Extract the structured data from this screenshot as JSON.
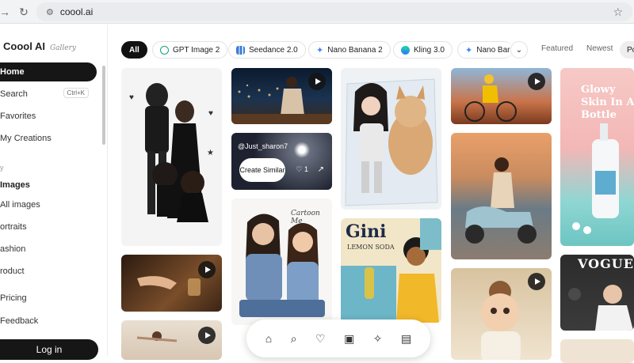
{
  "browser": {
    "url": "coool.ai"
  },
  "brand": {
    "name": "Coool AI",
    "sub": "Gallery"
  },
  "sidebar": {
    "items": [
      {
        "label": "Home"
      },
      {
        "label": "Search",
        "shortcut": "Ctrl+K"
      },
      {
        "label": "Favorites"
      },
      {
        "label": "My Creations"
      }
    ],
    "category_label": "y",
    "images_title": "Images",
    "image_items": [
      {
        "label": "All images"
      },
      {
        "label": "ortraits"
      },
      {
        "label": "ashion"
      },
      {
        "label": "roduct"
      }
    ],
    "footer_items": [
      {
        "label": "Pricing"
      },
      {
        "label": "Feedback"
      }
    ],
    "login_label": "Log in"
  },
  "filters": {
    "chips": [
      {
        "label": "All"
      },
      {
        "label": "GPT Image 2"
      },
      {
        "label": "Seedance 2.0"
      },
      {
        "label": "Nano Banana 2"
      },
      {
        "label": "Kling 3.0"
      },
      {
        "label": "Nano Bar"
      }
    ],
    "sort": [
      "Featured",
      "Newest",
      "Po"
    ]
  },
  "cards": {
    "overlay_user": "@Just_sharon7",
    "create_similar": "Create Similar",
    "likes": "1",
    "poster_glowy": "Glowy Skin In A Bottle",
    "poster_gini": "Gini",
    "poster_lemon": "LEMON SODA",
    "poster_vogue": "VOGUE",
    "cartoon_me": "Cartoon Me"
  },
  "colors": {
    "accent": "#111111",
    "chrome": "#f1f3f4"
  }
}
